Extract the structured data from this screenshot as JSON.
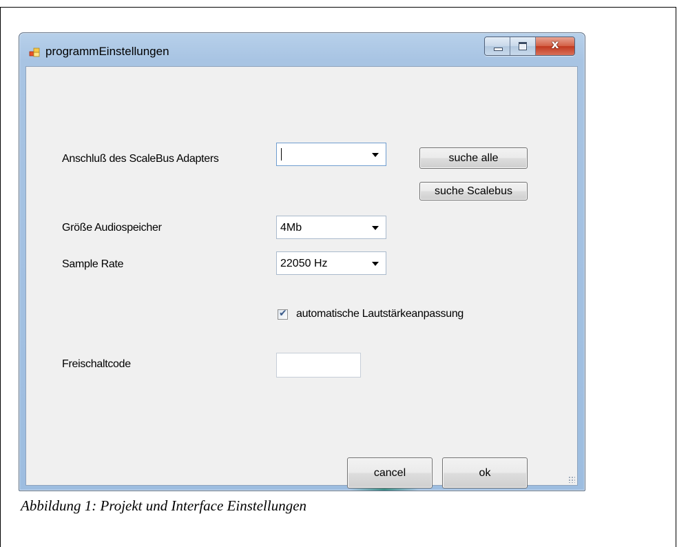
{
  "window": {
    "title": "programmEinstellungen",
    "icon": "application-icon",
    "caption_buttons": {
      "minimize": "minimize-icon",
      "maximize": "maximize-icon",
      "close_glyph": "x"
    }
  },
  "form": {
    "adapter": {
      "label": "Anschluß des ScaleBus Adapters",
      "value": ""
    },
    "search_all_label": "suche alle",
    "search_scalebus_label": "suche Scalebus",
    "audio_memory": {
      "label": "Größe Audiospeicher",
      "value": "4Mb"
    },
    "sample_rate": {
      "label": "Sample Rate",
      "value": "22050 Hz"
    },
    "auto_volume": {
      "label": "automatische Lautstärkeanpassung",
      "checked": true
    },
    "unlock_code": {
      "label": "Freischaltcode",
      "value": ""
    },
    "cancel_label": "cancel",
    "ok_label": "ok"
  },
  "document": {
    "caption": "Abbildung 1: Projekt und Interface Einstellungen"
  },
  "colors": {
    "window_frame": "#a8c4e3",
    "close_button": "#c1391f",
    "client_background": "#f0f0f0"
  }
}
